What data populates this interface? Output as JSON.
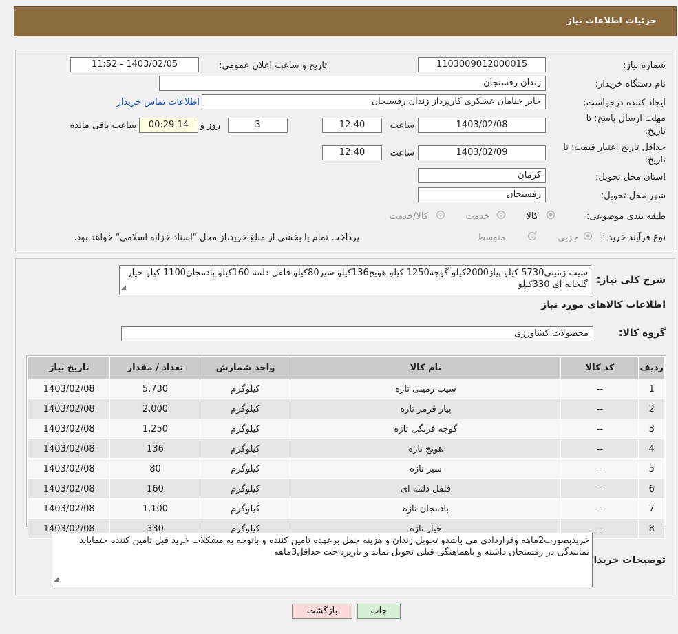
{
  "header": {
    "title": "جزئیات اطلاعات نیاز"
  },
  "form": {
    "need_number_label": "شماره نیاز:",
    "need_number": "1103009012000015",
    "announce_label": "تاریخ و ساعت اعلان عمومی:",
    "announce_value": "1403/02/05 - 11:52",
    "buyer_org_label": "نام دستگاه خریدار:",
    "buyer_org": "زندان رفسنجان",
    "creator_label": "ایجاد کننده درخواست:",
    "creator": "جابر خنامان عسکری کارپرداز زندان رفسنجان",
    "contact_link": "اطلاعات تماس خریدار",
    "deadline_label_1": "مهلت ارسال پاسخ: تا",
    "deadline_label_2": "تاریخ:",
    "deadline_date": "1403/02/08",
    "time_label": "ساعت",
    "deadline_time": "12:40",
    "days_value": "3",
    "days_label": "روز و",
    "remaining_time": "00:29:14",
    "remaining_label": "ساعت باقی مانده",
    "validity_label_1": "حداقل تاریخ اعتبار قیمت: تا",
    "validity_label_2": "تاریخ:",
    "validity_date": "1403/02/09",
    "validity_time": "12:40",
    "province_label": "استان محل تحویل:",
    "province": "کرمان",
    "city_label": "شهر محل تحویل:",
    "city": "رفسنجان",
    "category_label": "طبقه بندی موضوعی:",
    "category_options": [
      "کالا",
      "خدمت",
      "کالا/خدمت"
    ],
    "process_label": "نوع فرآیند خرید :",
    "process_options": [
      "جزیی",
      "متوسط"
    ],
    "process_note": "پرداخت تمام یا بخشی از مبلغ خرید،از محل \"اسناد خزانه اسلامی\" خواهد بود."
  },
  "details": {
    "summary_label": "شرح کلی نیاز:",
    "summary_text": "سیب زمینی5730 کیلو پیاز2000کیلو گوجه1250 کیلو هویج136کیلو سیر80کیلو فلفل دلمه 160کیلو بادمجان1100 کیلو خیار گلخانه ای 330کیلو",
    "goods_info_title": "اطلاعات کالاهای مورد نیاز",
    "goods_group_label": "گروه کالا:",
    "goods_group": "محصولات کشاورزی",
    "table": {
      "headers": [
        "ردیف",
        "کد کالا",
        "نام کالا",
        "واحد شمارش",
        "تعداد / مقدار",
        "تاریخ نیاز"
      ],
      "rows": [
        [
          "1",
          "--",
          "سیب زمینی تازه",
          "کیلوگرم",
          "5,730",
          "1403/02/08"
        ],
        [
          "2",
          "--",
          "پیاز قرمز تازه",
          "کیلوگرم",
          "2,000",
          "1403/02/08"
        ],
        [
          "3",
          "--",
          "گوجه فرنگی تازه",
          "کیلوگرم",
          "1,250",
          "1403/02/08"
        ],
        [
          "4",
          "--",
          "هویج تازه",
          "کیلوگرم",
          "136",
          "1403/02/08"
        ],
        [
          "5",
          "--",
          "سیر تازه",
          "کیلوگرم",
          "80",
          "1403/02/08"
        ],
        [
          "6",
          "--",
          "فلفل دلمه ای",
          "کیلوگرم",
          "160",
          "1403/02/08"
        ],
        [
          "7",
          "--",
          "بادمجان تازه",
          "کیلوگرم",
          "1,100",
          "1403/02/08"
        ],
        [
          "8",
          "--",
          "خیار تازه",
          "کیلوگرم",
          "330",
          "1403/02/08"
        ]
      ]
    },
    "buyer_notes_label": "توضیحات خریدار:",
    "buyer_notes": "خریدبصورت2ماهه وقراردادی می باشدو تحویل زندان و هزینه حمل برعهده تامین کننده و باتوجه به مشکلات خرید قبل تامین کننده حتمابابد نمایندگی در رفسنجان داشته و باهماهنگی قبلی تحویل نماید و بازپرداخت حداقل3ماهه"
  },
  "buttons": {
    "print": "چاپ",
    "back": "بازگشت"
  },
  "colors": {
    "header_bg": "#8b6a3d",
    "back_button_bg": "#f9d9d9",
    "print_button_bg": "#d6f0d6",
    "link": "#1a53c9"
  }
}
